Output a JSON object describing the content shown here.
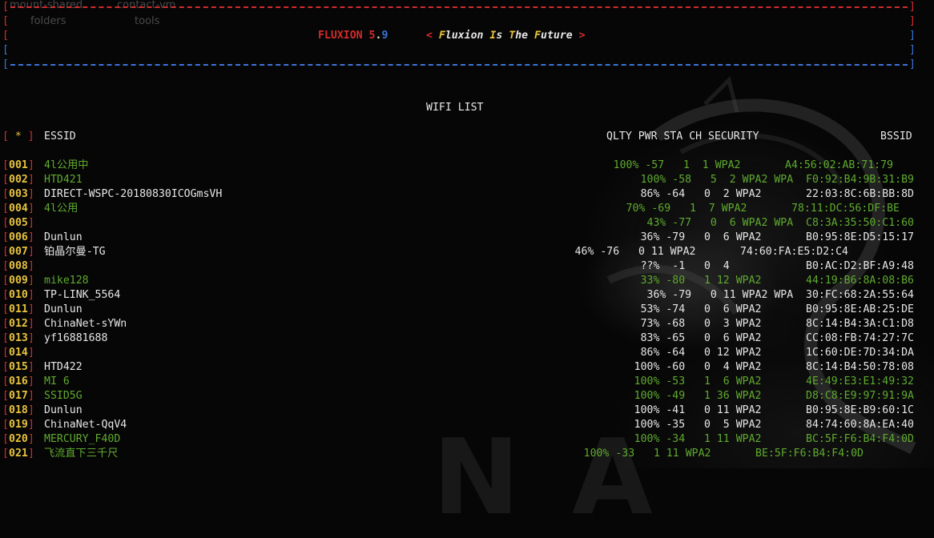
{
  "desktop_ghost": {
    "label_1": "mount-shared",
    "label_2": "contact-vm",
    "label_3": "folders",
    "label_4": "tools"
  },
  "header": {
    "app_name": "FLUXION",
    "version_major": "5",
    "version_dot": ".",
    "version_minor": "9",
    "tagline_open": "< ",
    "tagline_f": "F",
    "tagline_1": "luxion ",
    "tagline_i": "I",
    "tagline_2": "s ",
    "tagline_t": "T",
    "tagline_3": "he ",
    "tagline_f2": "F",
    "tagline_4": "uture",
    "tagline_close": " >"
  },
  "list_title": "WIFI LIST",
  "columns": {
    "select_open": "[",
    "select_star": " * ",
    "select_close": "]",
    "essid": "ESSID",
    "stats": "QLTY PWR STA CH SECURITY",
    "bssid": "BSSID"
  },
  "colors": {
    "accent_red": "#d22c2c",
    "accent_blue": "#3d73d6",
    "index_yellow": "#e6c23d",
    "client_green": "#5faa2e",
    "text_white": "#e6e6e6"
  },
  "rows": [
    {
      "idx": "001",
      "essid": "4l公用中",
      "stats": "100% -57   1  1 WPA2       A4:56:02:AB:71:79",
      "green": true,
      "shift": 26
    },
    {
      "idx": "002",
      "essid": "HTD421",
      "stats": "100% -58   5  2 WPA2 WPA  F0:92:B4:9B:31:B9",
      "green": true,
      "shift": 0
    },
    {
      "idx": "003",
      "essid": "DIRECT-WSPC-20180830ICOGmsVH",
      "stats": " 86% -64   0  2 WPA2       22:03:8C:6B:BB:8D",
      "green": false,
      "shift": 0
    },
    {
      "idx": "004",
      "essid": "4l公用",
      "stats": " 70% -69   1  7 WPA2       78:11:DC:56:DF:BE",
      "green": true,
      "shift": 18
    },
    {
      "idx": "005",
      "essid": "",
      "stats": " 43% -77   0  6 WPA2 WPA  C8:3A:35:50:C1:60",
      "green": true,
      "shift": 0
    },
    {
      "idx": "006",
      "essid": "Dunlun",
      "stats": " 36% -79   0  6 WPA2       B0:95:8E:D5:15:17",
      "green": false,
      "shift": 0
    },
    {
      "idx": "007",
      "essid": "铂晶尔曼-TG",
      "stats": "46% -76   0 11 WPA2       74:60:FA:E5:D2:C4",
      "green": false,
      "shift": 82
    },
    {
      "idx": "008",
      "essid": "",
      "stats": " ??%  -1   0  4            B0:AC:D2:BF:A9:48",
      "green": false,
      "shift": 0
    },
    {
      "idx": "009",
      "essid": "mike128",
      "stats": " 33% -80   1 12 WPA2       44:19:B6:8A:08:B6",
      "green": true,
      "shift": 0
    },
    {
      "idx": "010",
      "essid": "TP-LINK_5564",
      "stats": " 36% -79   0 11 WPA2 WPA  30:FC:68:2A:55:64",
      "green": false,
      "shift": 0
    },
    {
      "idx": "011",
      "essid": "Dunlun",
      "stats": " 53% -74   0  6 WPA2       B0:95:8E:AB:25:DE",
      "green": false,
      "shift": 0
    },
    {
      "idx": "012",
      "essid": "ChinaNet-sYWn",
      "stats": " 73% -68   0  3 WPA2       8C:14:B4:3A:C1:D8",
      "green": false,
      "shift": 0
    },
    {
      "idx": "013",
      "essid": "yf16881688",
      "stats": " 83% -65   0  6 WPA2       CC:08:FB:74:27:7C",
      "green": false,
      "shift": 0
    },
    {
      "idx": "014",
      "essid": "",
      "stats": " 86% -64   0 12 WPA2       1C:60:DE:7D:34:DA",
      "green": false,
      "shift": 0
    },
    {
      "idx": "015",
      "essid": "HTD422",
      "stats": "100% -60   0  4 WPA2       8C:14:B4:50:78:08",
      "green": false,
      "shift": 0
    },
    {
      "idx": "016",
      "essid": "MI 6",
      "stats": "100% -53   1  6 WPA2       4E:49:E3:E1:49:32",
      "green": true,
      "shift": 0
    },
    {
      "idx": "017",
      "essid": "SSID5G",
      "stats": "100% -49   1 36 WPA2       D8:C8:E9:97:91:9A",
      "green": true,
      "shift": 0
    },
    {
      "idx": "018",
      "essid": "Dunlun",
      "stats": "100% -41   0 11 WPA2       B0:95:8E:B9:60:1C",
      "green": false,
      "shift": 0
    },
    {
      "idx": "019",
      "essid": "ChinaNet-QqV4",
      "stats": "100% -35   0  5 WPA2       84:74:60:8A:EA:40",
      "green": false,
      "shift": 0
    },
    {
      "idx": "020",
      "essid": "MERCURY_F40D",
      "stats": "100% -34   1 11 WPA2       BC:5F:F6:B4:F4:0D",
      "green": true,
      "shift": 0
    },
    {
      "idx": "021",
      "essid": "飞流直下三千尺",
      "stats": "100% -33   1 11 WPA2       BE:5F:F6:B4:F4:0D",
      "green": true,
      "shift": 63
    }
  ]
}
